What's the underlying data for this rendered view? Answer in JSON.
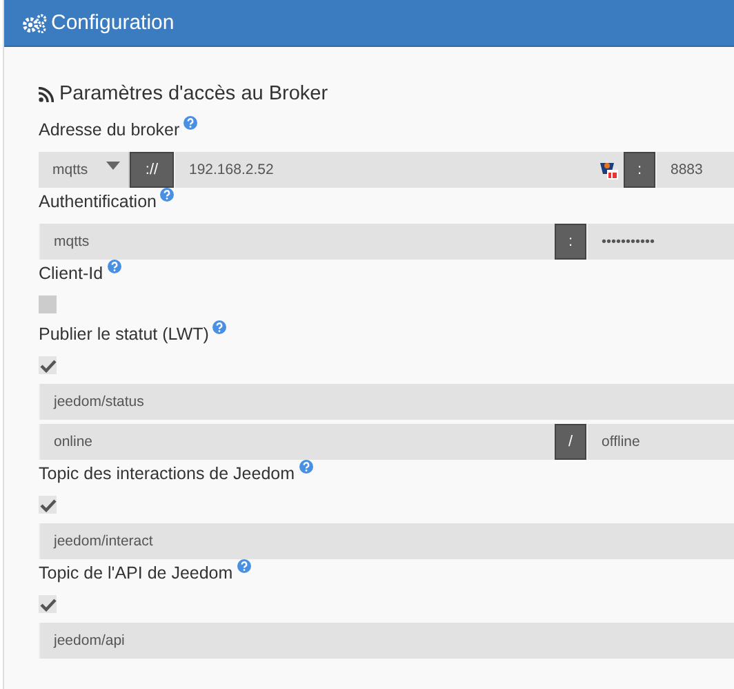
{
  "panel": {
    "title": "Configuration"
  },
  "section": {
    "title": "Paramètres d'accès au Broker"
  },
  "groups": [
    {
      "label": "Adresse du broker",
      "rows": [
        [
          {
            "kind": "select",
            "value": "mqtts"
          },
          {
            "kind": "addon",
            "text": "://"
          },
          {
            "kind": "input",
            "value": "192.168.2.52",
            "extension_icon": true
          },
          {
            "kind": "addon",
            "text": ":"
          },
          {
            "kind": "input",
            "value": "8883"
          }
        ]
      ]
    },
    {
      "label": "Authentification",
      "rows": [
        [
          {
            "kind": "input",
            "value": "mqtts"
          },
          {
            "kind": "addon",
            "text": ":"
          },
          {
            "kind": "password",
            "value": "•••••••••••"
          }
        ]
      ]
    },
    {
      "label": "Client-Id",
      "checkbox": {
        "checked": false
      }
    },
    {
      "label": "Publier le statut (LWT)",
      "checkbox": {
        "checked": true
      },
      "rows": [
        [
          {
            "kind": "input",
            "value": "jeedom/status"
          }
        ],
        [
          {
            "kind": "input",
            "value": "online"
          },
          {
            "kind": "addon",
            "text": "/"
          },
          {
            "kind": "input",
            "value": "offline"
          }
        ]
      ]
    },
    {
      "label": "Topic des interactions de Jeedom",
      "checkbox": {
        "checked": true
      },
      "rows": [
        [
          {
            "kind": "input",
            "value": "jeedom/interact"
          }
        ]
      ]
    },
    {
      "label": "Topic de l'API de Jeedom",
      "checkbox": {
        "checked": true
      },
      "rows": [
        [
          {
            "kind": "input",
            "value": "jeedom/api"
          }
        ]
      ]
    }
  ]
}
